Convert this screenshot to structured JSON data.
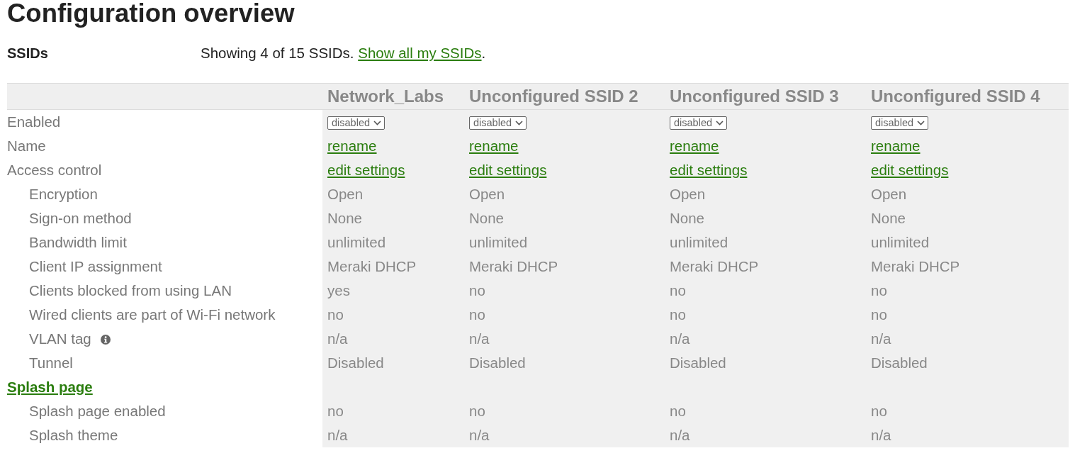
{
  "title": "Configuration overview",
  "ssids": {
    "label": "SSIDs",
    "summary": "Showing 4 of 15 SSIDs.",
    "link": "Show all my SSIDs",
    "end": "."
  },
  "table": {
    "columns": [
      "Network_Labs",
      "Unconfigured SSID 2",
      "Unconfigured SSID 3",
      "Unconfigured SSID 4"
    ],
    "rows": [
      {
        "kind": "select",
        "label": "Enabled",
        "cells": [
          "disabled",
          "disabled",
          "disabled",
          "disabled"
        ]
      },
      {
        "kind": "link",
        "label": "Name",
        "cells": [
          "rename",
          "rename",
          "rename",
          "rename"
        ]
      },
      {
        "kind": "link",
        "label": "Access control",
        "cells": [
          "edit settings",
          "edit settings",
          "edit settings",
          "edit settings"
        ],
        "children": [
          {
            "kind": "text",
            "label": "Encryption",
            "info": false,
            "cells": [
              "Open",
              "Open",
              "Open",
              "Open"
            ]
          },
          {
            "kind": "text",
            "label": "Sign-on method",
            "info": false,
            "cells": [
              "None",
              "None",
              "None",
              "None"
            ]
          },
          {
            "kind": "text",
            "label": "Bandwidth limit",
            "info": false,
            "cells": [
              "unlimited",
              "unlimited",
              "unlimited",
              "unlimited"
            ]
          },
          {
            "kind": "text",
            "label": "Client IP assignment",
            "info": false,
            "cells": [
              "Meraki DHCP",
              "Meraki DHCP",
              "Meraki DHCP",
              "Meraki DHCP"
            ]
          },
          {
            "kind": "text",
            "label": "Clients blocked from using LAN",
            "info": false,
            "cells": [
              "yes",
              "no",
              "no",
              "no"
            ]
          },
          {
            "kind": "text",
            "label": "Wired clients are part of Wi-Fi network",
            "info": false,
            "cells": [
              "no",
              "no",
              "no",
              "no"
            ]
          },
          {
            "kind": "text",
            "label": "VLAN tag",
            "info": true,
            "cells": [
              "n/a",
              "n/a",
              "n/a",
              "n/a"
            ]
          },
          {
            "kind": "text",
            "label": "Tunnel",
            "info": false,
            "cells": [
              "Disabled",
              "Disabled",
              "Disabled",
              "Disabled"
            ]
          }
        ]
      },
      {
        "kind": "section",
        "label": "Splash page",
        "children": [
          {
            "kind": "text",
            "label": "Splash page enabled",
            "info": false,
            "cells": [
              "no",
              "no",
              "no",
              "no"
            ]
          },
          {
            "kind": "text",
            "label": "Splash theme",
            "info": false,
            "cells": [
              "n/a",
              "n/a",
              "n/a",
              "n/a"
            ]
          }
        ]
      }
    ]
  }
}
